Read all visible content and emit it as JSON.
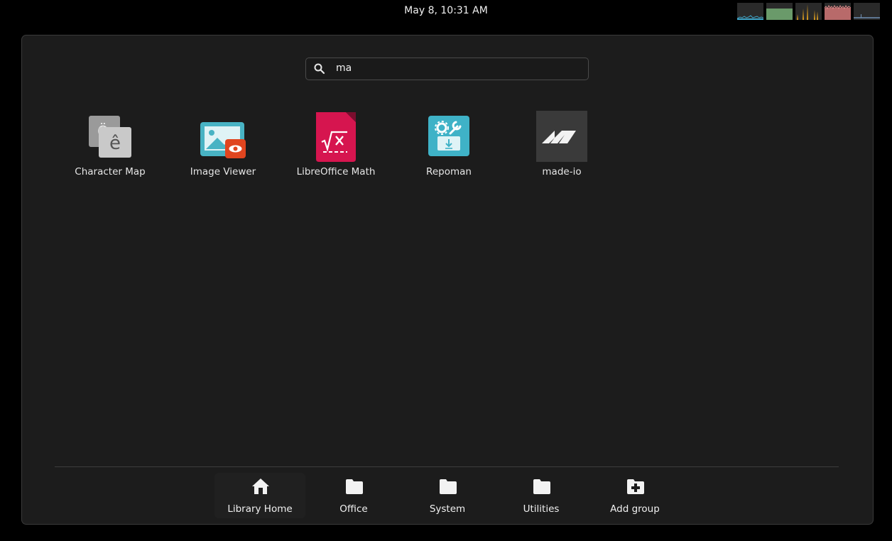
{
  "topbar": {
    "clock": "May 8, 10:31 AM",
    "monitors": [
      {
        "icon": "cpu-graph-icon",
        "color": "#3fa6c9"
      },
      {
        "icon": "memory-graph-icon",
        "color": "#6a9a6a"
      },
      {
        "icon": "network-graph-icon",
        "color": "#e0a020"
      },
      {
        "icon": "swap-graph-icon",
        "color": "#c46060"
      },
      {
        "icon": "disk-graph-icon",
        "color": "#6f8fb3"
      }
    ]
  },
  "search": {
    "query": "ma",
    "icon": "search-icon"
  },
  "apps": [
    {
      "name": "character-map",
      "label": "Character Map",
      "icon": "character-map-icon"
    },
    {
      "name": "image-viewer",
      "label": "Image Viewer",
      "icon": "image-viewer-icon"
    },
    {
      "name": "libreoffice-math",
      "label": "LibreOffice Math",
      "icon": "libreoffice-math-icon"
    },
    {
      "name": "repoman",
      "label": "Repoman",
      "icon": "repoman-icon"
    },
    {
      "name": "made-io",
      "label": "made-io",
      "icon": "made-io-icon"
    }
  ],
  "groups": [
    {
      "label": "Library Home",
      "icon": "home-icon",
      "active": true
    },
    {
      "label": "Office",
      "icon": "folder-icon"
    },
    {
      "label": "System",
      "icon": "folder-icon"
    },
    {
      "label": "Utilities",
      "icon": "folder-icon"
    },
    {
      "label": "Add group",
      "icon": "folder-add-icon"
    }
  ],
  "colors": {
    "panel_bg": "#1c1c1c",
    "math_red": "#d6154f",
    "repoman_teal": "#3fb2c7",
    "imageviewer_teal": "#48b3c4",
    "imageviewer_badge": "#e0451f"
  }
}
